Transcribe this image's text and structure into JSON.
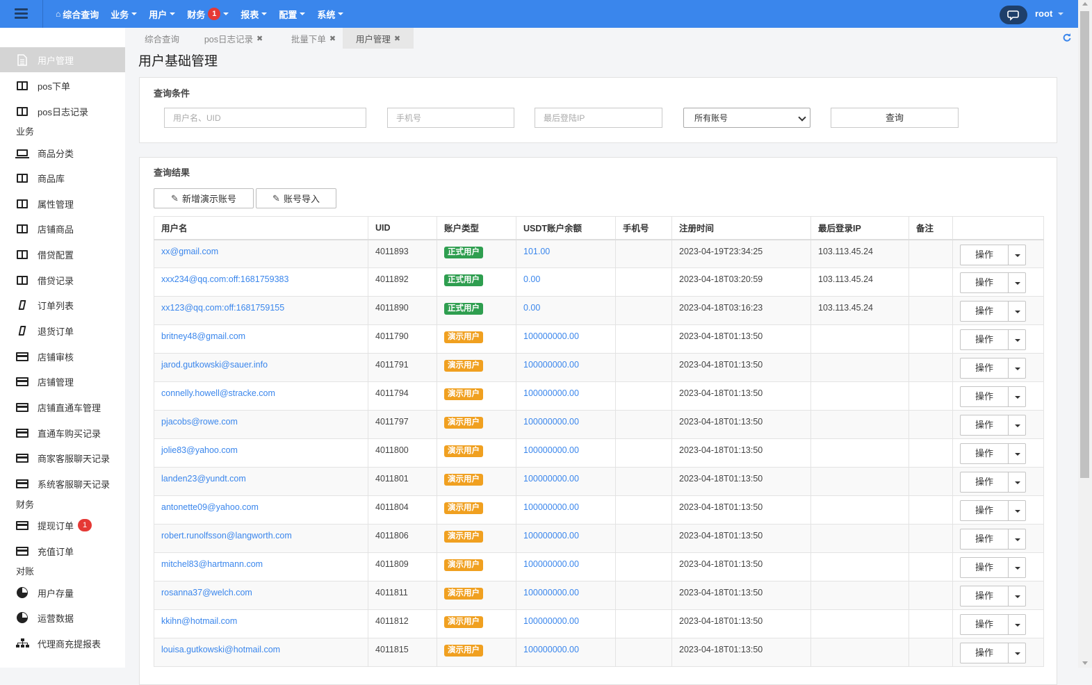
{
  "topbar": {
    "nav": [
      {
        "label": "综合查询",
        "icon": "home-icon",
        "caret": false
      },
      {
        "label": "业务",
        "caret": true
      },
      {
        "label": "用户",
        "caret": true
      },
      {
        "label": "财务",
        "caret": true,
        "badge": "1"
      },
      {
        "label": "报表",
        "caret": true
      },
      {
        "label": "配置",
        "caret": true
      },
      {
        "label": "系统",
        "caret": true
      }
    ],
    "user": "root",
    "colors": {
      "bar": "#3a86ec",
      "badge": "#e53935"
    }
  },
  "sidebar": {
    "items": [
      {
        "label": "用户管理",
        "icon": "file-icon",
        "active": true
      },
      {
        "label": "pos下单",
        "icon": "book-icon"
      },
      {
        "label": "pos日志记录",
        "icon": "book-icon"
      },
      {
        "section": "业务"
      },
      {
        "label": "商品分类",
        "icon": "laptop-icon"
      },
      {
        "label": "商品库",
        "icon": "book-icon"
      },
      {
        "label": "属性管理",
        "icon": "book-icon"
      },
      {
        "label": "店铺商品",
        "icon": "book-icon"
      },
      {
        "label": "借贷配置",
        "icon": "book-icon"
      },
      {
        "label": "借贷记录",
        "icon": "book-icon"
      },
      {
        "label": "订单列表",
        "icon": "mobile-icon"
      },
      {
        "label": "退货订单",
        "icon": "mobile-icon"
      },
      {
        "label": "店铺审核",
        "icon": "credit-card-icon"
      },
      {
        "label": "店铺管理",
        "icon": "credit-card-icon"
      },
      {
        "label": "店铺直通车管理",
        "icon": "credit-card-icon"
      },
      {
        "label": "直通车购买记录",
        "icon": "credit-card-icon"
      },
      {
        "label": "商家客服聊天记录",
        "icon": "credit-card-icon"
      },
      {
        "label": "系统客服聊天记录",
        "icon": "credit-card-icon"
      },
      {
        "section": "财务"
      },
      {
        "label": "提现订单",
        "icon": "credit-card-icon",
        "badge": "1"
      },
      {
        "label": "充值订单",
        "icon": "credit-card-icon"
      },
      {
        "section": "对账"
      },
      {
        "label": "用户存量",
        "icon": "pie-chart-icon"
      },
      {
        "label": "运营数据",
        "icon": "pie-chart-icon"
      },
      {
        "label": "代理商充提报表",
        "icon": "sitemap-icon"
      }
    ]
  },
  "tabs": [
    {
      "label": "综合查询",
      "closable": false,
      "active": false
    },
    {
      "label": "pos日志记录",
      "closable": true,
      "active": false
    },
    {
      "label": "批量下单",
      "closable": true,
      "active": false
    },
    {
      "label": "用户管理",
      "closable": true,
      "active": true
    }
  ],
  "page_title": "用户基础管理",
  "query": {
    "title": "查询条件",
    "username_placeholder": "用户名、UID",
    "phone_placeholder": "手机号",
    "ip_placeholder": "最后登陆IP",
    "account_select": "所有账号",
    "submit": "查询"
  },
  "results": {
    "title": "查询结果",
    "add_demo": "新增演示账号",
    "import": "账号导入",
    "columns": [
      "用户名",
      "UID",
      "账户类型",
      "USDT账户余额",
      "手机号",
      "注册时间",
      "最后登录IP",
      "备注",
      ""
    ],
    "action_label": "操作",
    "type_colors": {
      "正式用户": "#2e9e4f",
      "演示用户": "#f0a020"
    },
    "rows": [
      {
        "username": "xx@gmail.com",
        "uid": "4011893",
        "type": "正式用户",
        "balance": "101.00",
        "phone": "",
        "registered": "2023-04-19T23:34:25",
        "last_ip": "103.113.45.24",
        "note": ""
      },
      {
        "username": "xxx234@qq.com:off:1681759383",
        "uid": "4011892",
        "type": "正式用户",
        "balance": "0.00",
        "phone": "",
        "registered": "2023-04-18T03:20:59",
        "last_ip": "103.113.45.24",
        "note": ""
      },
      {
        "username": "xx123@qq.com:off:1681759155",
        "uid": "4011890",
        "type": "正式用户",
        "balance": "0.00",
        "phone": "",
        "registered": "2023-04-18T03:16:23",
        "last_ip": "103.113.45.24",
        "note": ""
      },
      {
        "username": "britney48@gmail.com",
        "uid": "4011790",
        "type": "演示用户",
        "balance": "100000000.00",
        "phone": "",
        "registered": "2023-04-18T01:13:50",
        "last_ip": "",
        "note": ""
      },
      {
        "username": "jarod.gutkowski@sauer.info",
        "uid": "4011791",
        "type": "演示用户",
        "balance": "100000000.00",
        "phone": "",
        "registered": "2023-04-18T01:13:50",
        "last_ip": "",
        "note": ""
      },
      {
        "username": "connelly.howell@stracke.com",
        "uid": "4011794",
        "type": "演示用户",
        "balance": "100000000.00",
        "phone": "",
        "registered": "2023-04-18T01:13:50",
        "last_ip": "",
        "note": ""
      },
      {
        "username": "pjacobs@rowe.com",
        "uid": "4011797",
        "type": "演示用户",
        "balance": "100000000.00",
        "phone": "",
        "registered": "2023-04-18T01:13:50",
        "last_ip": "",
        "note": ""
      },
      {
        "username": "jolie83@yahoo.com",
        "uid": "4011800",
        "type": "演示用户",
        "balance": "100000000.00",
        "phone": "",
        "registered": "2023-04-18T01:13:50",
        "last_ip": "",
        "note": ""
      },
      {
        "username": "landen23@yundt.com",
        "uid": "4011801",
        "type": "演示用户",
        "balance": "100000000.00",
        "phone": "",
        "registered": "2023-04-18T01:13:50",
        "last_ip": "",
        "note": ""
      },
      {
        "username": "antonette09@yahoo.com",
        "uid": "4011804",
        "type": "演示用户",
        "balance": "100000000.00",
        "phone": "",
        "registered": "2023-04-18T01:13:50",
        "last_ip": "",
        "note": ""
      },
      {
        "username": "robert.runolfsson@langworth.com",
        "uid": "4011806",
        "type": "演示用户",
        "balance": "100000000.00",
        "phone": "",
        "registered": "2023-04-18T01:13:50",
        "last_ip": "",
        "note": ""
      },
      {
        "username": "mitchel83@hartmann.com",
        "uid": "4011809",
        "type": "演示用户",
        "balance": "100000000.00",
        "phone": "",
        "registered": "2023-04-18T01:13:50",
        "last_ip": "",
        "note": ""
      },
      {
        "username": "rosanna37@welch.com",
        "uid": "4011811",
        "type": "演示用户",
        "balance": "100000000.00",
        "phone": "",
        "registered": "2023-04-18T01:13:50",
        "last_ip": "",
        "note": ""
      },
      {
        "username": "kkihn@hotmail.com",
        "uid": "4011812",
        "type": "演示用户",
        "balance": "100000000.00",
        "phone": "",
        "registered": "2023-04-18T01:13:50",
        "last_ip": "",
        "note": ""
      },
      {
        "username": "louisa.gutkowski@hotmail.com",
        "uid": "4011815",
        "type": "演示用户",
        "balance": "100000000.00",
        "phone": "",
        "registered": "2023-04-18T01:13:50",
        "last_ip": "",
        "note": ""
      }
    ]
  }
}
